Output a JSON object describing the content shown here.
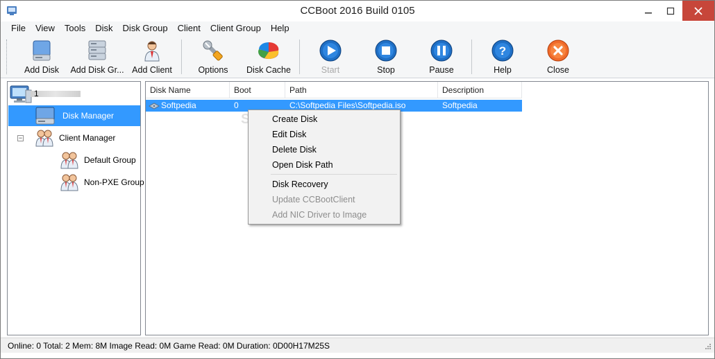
{
  "window": {
    "title": "CCBoot 2016 Build 0105"
  },
  "menu": [
    "File",
    "View",
    "Tools",
    "Disk",
    "Disk Group",
    "Client",
    "Client Group",
    "Help"
  ],
  "toolbar": {
    "add_disk": "Add Disk",
    "add_disk_group": "Add Disk Gr...",
    "add_client": "Add Client",
    "options": "Options",
    "disk_cache": "Disk Cache",
    "start": "Start",
    "stop": "Stop",
    "pause": "Pause",
    "help": "Help",
    "close": "Close"
  },
  "tree": {
    "root": "1          ",
    "disk_manager": "Disk Manager",
    "client_manager": "Client Manager",
    "default_group": "Default Group",
    "non_pxe_group": "Non-PXE Group",
    "expander": "−"
  },
  "list": {
    "columns": [
      "Disk Name",
      "Boot",
      "Path",
      "Description"
    ],
    "rows": [
      {
        "disk_name": "Softpedia",
        "boot": "0",
        "path": "C:\\Softpedia Files\\Softpedia.iso",
        "description": "Softpedia"
      }
    ]
  },
  "context_menu": {
    "items": [
      "Create Disk",
      "Edit Disk",
      "Delete Disk",
      "Open Disk Path",
      "Disk Recovery",
      "Update CCBootClient",
      "Add NIC Driver to Image"
    ]
  },
  "watermark": "SOFTPEDIA",
  "status": {
    "text": "Online: 0 Total: 2 Mem: 8M Image Read: 0M Game Read: 0M Duration: 0D00H17M25S"
  },
  "colors": {
    "selection": "#3399ff",
    "close_button": "#c7463a"
  }
}
